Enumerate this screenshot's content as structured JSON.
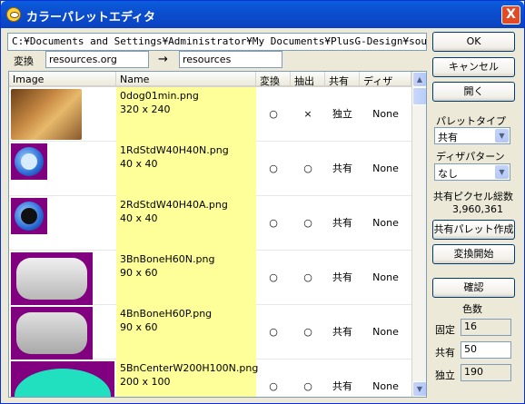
{
  "window": {
    "title": "カラーパレットエディタ",
    "close_glyph": "X"
  },
  "path": {
    "value": "C:¥Documents and Settings¥Administrator¥My Documents¥PlusG-Design¥source¥pgdemo"
  },
  "convert": {
    "label": "変換",
    "from_value": "resources.org",
    "arrow": "→",
    "to_value": "resources"
  },
  "buttons": {
    "ok": "OK",
    "cancel": "キャンセル",
    "open": "開く",
    "make_shared": "共有パレット作成",
    "start": "変換開始",
    "confirm": "確認"
  },
  "columns": [
    "Image",
    "Name",
    "変換",
    "抽出",
    "共有",
    "ディザ"
  ],
  "rows": [
    {
      "thumb": "dog",
      "name": "0dog01min.png",
      "size": "320 x 240",
      "convert": "○",
      "extract": "×",
      "share": "独立",
      "dither": "None"
    },
    {
      "thumb": "ring-n",
      "name": "1RdStdW40H40N.png",
      "size": "40 x 40",
      "convert": "○",
      "extract": "○",
      "share": "共有",
      "dither": "None"
    },
    {
      "thumb": "ring-a",
      "name": "2RdStdW40H40A.png",
      "size": "40 x 40",
      "convert": "○",
      "extract": "○",
      "share": "共有",
      "dither": "None"
    },
    {
      "thumb": "bone-n",
      "name": "3BnBoneH60N.png",
      "size": "90 x 60",
      "convert": "○",
      "extract": "○",
      "share": "共有",
      "dither": "None"
    },
    {
      "thumb": "bone-p",
      "name": "4BnBoneH60P.png",
      "size": "90 x 60",
      "convert": "○",
      "extract": "○",
      "share": "共有",
      "dither": "None"
    },
    {
      "thumb": "center",
      "name": "5BnCenterW200H100N.png",
      "size": "200 x 100",
      "convert": "○",
      "extract": "○",
      "share": "共有",
      "dither": "None"
    }
  ],
  "palette_type": {
    "label": "パレットタイプ",
    "value": "共有"
  },
  "dither_pattern": {
    "label": "ディザパターン",
    "value": "なし"
  },
  "shared_total": {
    "label": "共有ピクセル総数",
    "value": "3,960,361"
  },
  "colors": {
    "label": "色数",
    "fixed_label": "固定",
    "fixed_value": "16",
    "shared_label": "共有",
    "shared_value": "50",
    "independent_label": "独立",
    "independent_value": "190"
  },
  "icons": {
    "combo_arrow": "▼",
    "scroll_up": "▲",
    "scroll_down": "▼"
  }
}
